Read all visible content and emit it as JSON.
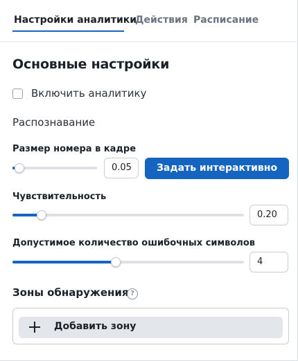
{
  "tabs": [
    {
      "label": "Настройки аналитики",
      "active": true
    },
    {
      "label": "Действия",
      "active": false
    },
    {
      "label": "Расписание",
      "active": false
    }
  ],
  "section_title": "Основные настройки",
  "enable_analytics": {
    "label": "Включить аналитику",
    "checked": false
  },
  "recognition_title": "Распознавание",
  "plate_size": {
    "label": "Размер номера в кадре",
    "value": "0.05",
    "fraction": 0.08,
    "button_label": "Задать интерактивно"
  },
  "sensitivity": {
    "label": "Чувствительность",
    "value": "0.20",
    "fraction": 0.125
  },
  "error_chars": {
    "label": "Допустимое количество ошибочных символов",
    "value": "4",
    "fraction": 0.445
  },
  "zones": {
    "title": "Зоны обнаружения",
    "help_icon": "help-circle-icon",
    "add_label": "Добавить зону",
    "add_icon": "plus-icon"
  },
  "colors": {
    "accent": "#1565c0",
    "track": "#dde1e6"
  }
}
